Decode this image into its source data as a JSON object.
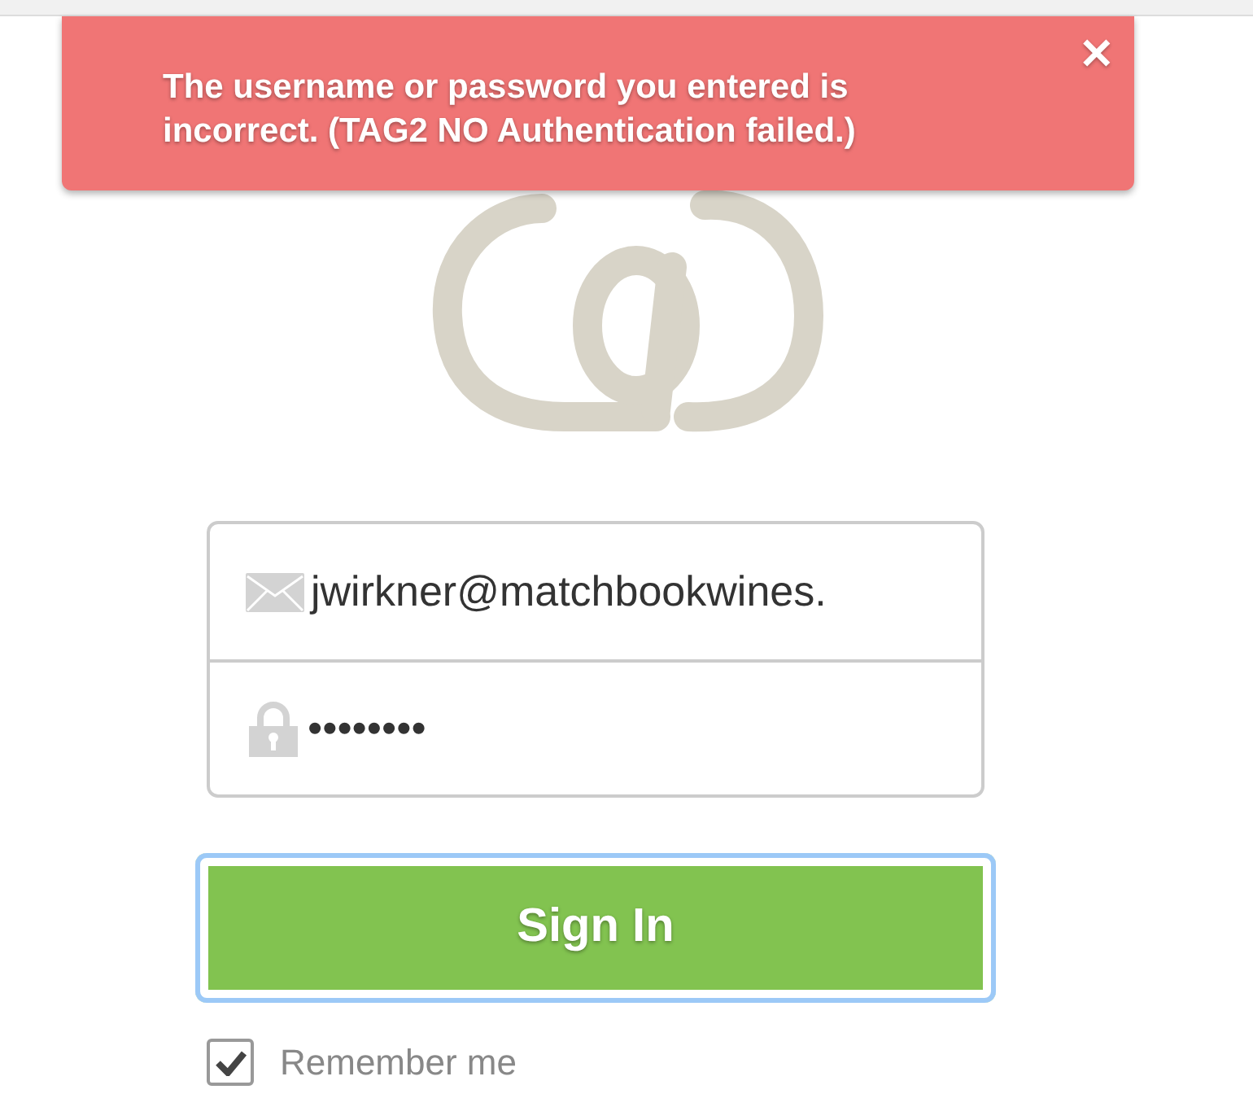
{
  "alert": {
    "message": "The username or password you entered is incorrect. (TAG2 NO Authentication failed.)",
    "close": "✕"
  },
  "form": {
    "email": {
      "value": "jwirkner@matchbookwines."
    },
    "password": {
      "value": "••••••••"
    }
  },
  "sign_in_button": {
    "label": "Sign In",
    "focused": true
  },
  "remember_me": {
    "label": "Remember me",
    "checked": true
  }
}
